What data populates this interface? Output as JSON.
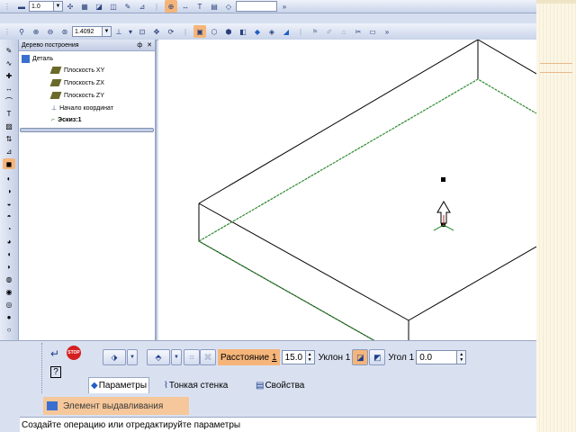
{
  "toolbar_top": {
    "line_scale_value": "1.0",
    "zoom_value": "1.4092"
  },
  "tree_panel": {
    "title": "Дерево построения",
    "pin_glyph": "ф",
    "close_glyph": "✕",
    "items": [
      {
        "label": "Деталь",
        "icon": "part-icon"
      },
      {
        "label": "Плоскость XY",
        "icon": "plane-icon"
      },
      {
        "label": "Плоскость ZX",
        "icon": "plane-icon"
      },
      {
        "label": "Плоскость ZY",
        "icon": "plane-icon"
      },
      {
        "label": "Начало координат",
        "icon": "origin-icon"
      },
      {
        "label": "Эскиз:1",
        "icon": "sketch-icon"
      }
    ]
  },
  "properties": {
    "distance_label": "Расстояние",
    "distance_index": "1",
    "distance_value": "15.0",
    "slope_label": "Уклон 1",
    "angle_label": "Угол 1",
    "angle_value": "0.0",
    "stop_label": "STOP"
  },
  "tabs": [
    {
      "label": "Параметры",
      "icon": "parameters-icon"
    },
    {
      "label": "Тонкая стенка",
      "icon": "thin-wall-icon"
    },
    {
      "label": "Свойства",
      "icon": "properties-icon"
    }
  ],
  "panel_caption": "Элемент выдавливания",
  "status_text": "Создайте операцию или отредактируйте параметры",
  "colors": {
    "highlight": "#f5b57a",
    "sketch_green": "#2e8a2e",
    "edge": "#000000"
  }
}
